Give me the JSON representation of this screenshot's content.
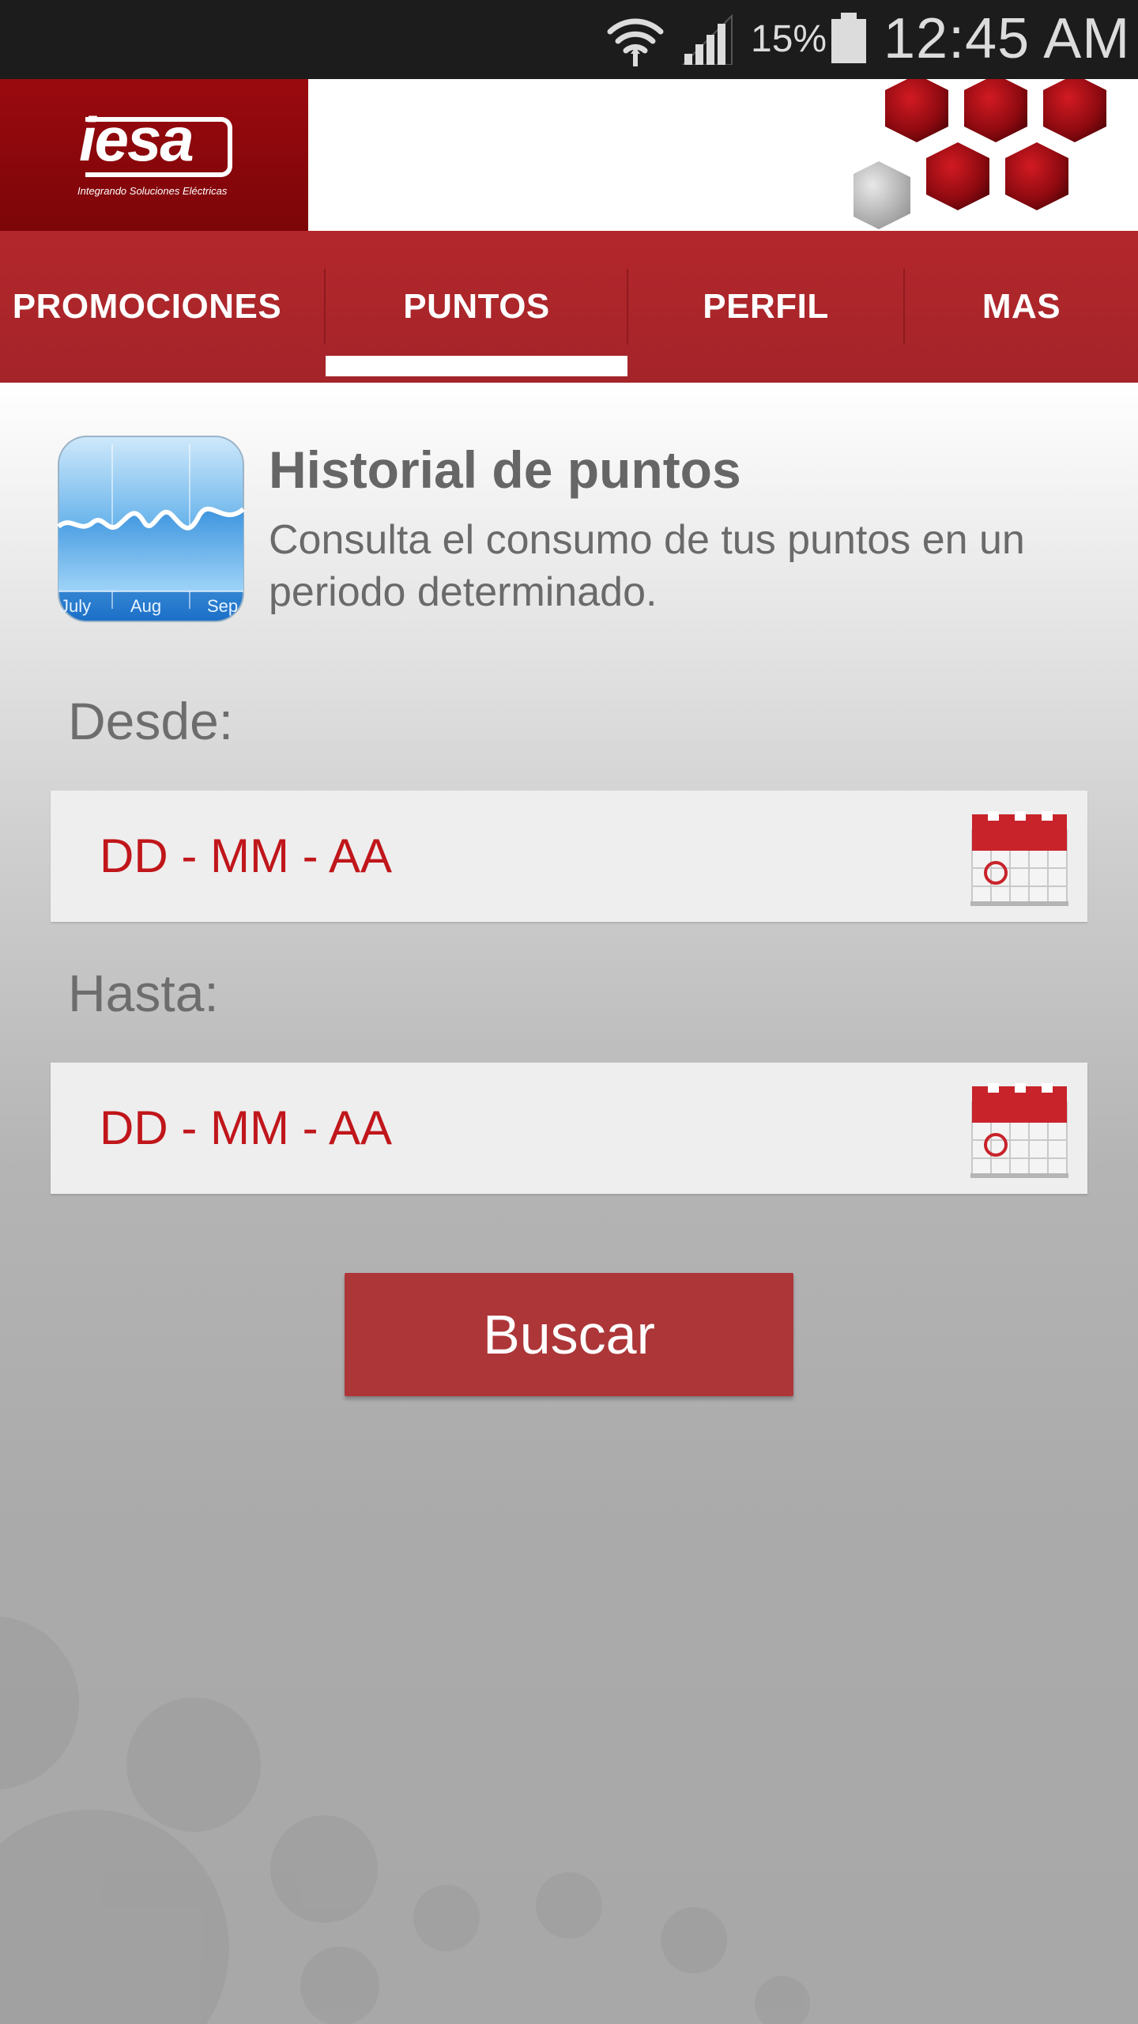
{
  "status_bar": {
    "battery_percent": "15%",
    "time": "12:45 AM",
    "icons": [
      "wifi-icon",
      "cell-signal-icon",
      "battery-icon"
    ]
  },
  "header": {
    "logo_text": "iesa",
    "logo_tagline": "Integrando Soluciones Eléctricas"
  },
  "tabs": [
    {
      "label": "PROMOCIONES",
      "selected": false
    },
    {
      "label": "PUNTOS",
      "selected": true
    },
    {
      "label": "PERFIL",
      "selected": false
    },
    {
      "label": "MAS",
      "selected": false
    }
  ],
  "history": {
    "title": "Historial de puntos",
    "description": "Consulta el consumo de tus puntos en un periodo determinado.",
    "icon": "stocks-chart-icon",
    "icon_labels": [
      "July",
      "Aug",
      "Sep"
    ]
  },
  "form": {
    "from_label": "Desde:",
    "from_placeholder": "DD - MM - AA",
    "to_label": "Hasta:",
    "to_placeholder": "DD - MM - AA",
    "search_button": "Buscar"
  },
  "colors": {
    "brand_red": "#a4242a",
    "logo_red": "#8a070b",
    "placeholder_red": "#c0161b",
    "button_red": "#ad3638"
  }
}
